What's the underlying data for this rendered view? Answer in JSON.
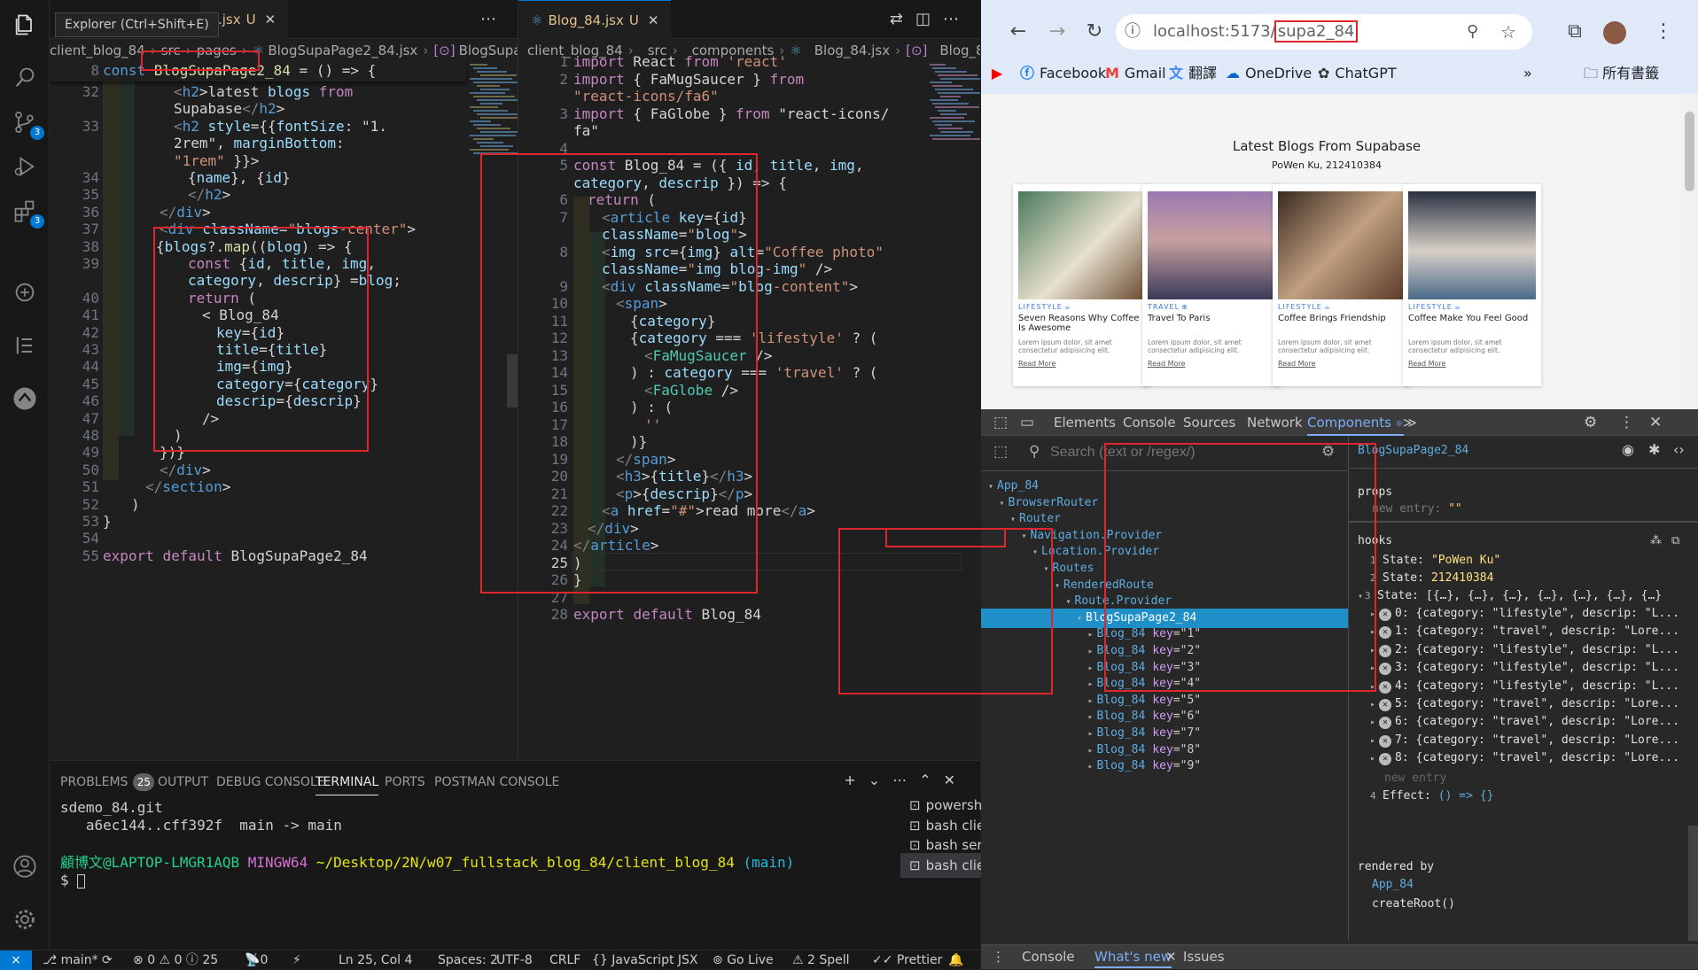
{
  "tooltip": "Explorer (Ctrl+Shift+E)",
  "left_editor": {
    "tab_label": ".jsx",
    "tab_status": "U",
    "breadcrumb": [
      "client_blog_84",
      "src",
      "pages",
      "BlogSupaPage2_84.jsx",
      "BlogSupaP"
    ],
    "sticky": {
      "ln": "8",
      "pre": "const ",
      "name": "BlogSupaPage2_84",
      "post": " = () => {"
    },
    "lines": [
      {
        "n": "32",
        "t": "<h2>latest blogs from"
      },
      {
        "n": "",
        "t": "Supabase</h2>"
      },
      {
        "n": "33",
        "t": "<h2 style={{fontSize: \"1."
      },
      {
        "n": "",
        "t": "2rem\", marginBottom:"
      },
      {
        "n": "",
        "t": "\"1rem\" }}>"
      },
      {
        "n": "34",
        "t": "{name}, {id}"
      },
      {
        "n": "35",
        "t": "</h2>"
      },
      {
        "n": "36",
        "t": "</div>"
      },
      {
        "n": "37",
        "t": "<div className=\"blogs-center\">"
      },
      {
        "n": "38",
        "t": "{blogs?.map((blog) => {"
      },
      {
        "n": "39",
        "t": "const {id, title, img,"
      },
      {
        "n": "",
        "t": "category, descrip} =blog;"
      },
      {
        "n": "40",
        "t": "return ("
      },
      {
        "n": "41",
        "t": "< Blog_84"
      },
      {
        "n": "42",
        "t": "key={id}"
      },
      {
        "n": "43",
        "t": "title={title}"
      },
      {
        "n": "44",
        "t": "img={img}"
      },
      {
        "n": "45",
        "t": "category={category}"
      },
      {
        "n": "46",
        "t": "descrip={descrip}"
      },
      {
        "n": "47",
        "t": "/>"
      },
      {
        "n": "48",
        "t": ")"
      },
      {
        "n": "49",
        "t": "})}"
      },
      {
        "n": "50",
        "t": "</div>"
      },
      {
        "n": "51",
        "t": "</section>"
      },
      {
        "n": "52",
        "t": ")"
      },
      {
        "n": "53",
        "t": "}"
      },
      {
        "n": "54",
        "t": ""
      },
      {
        "n": "55",
        "t": "export default BlogSupaPage2_84"
      }
    ]
  },
  "right_editor": {
    "tab_label": "Blog_84.jsx",
    "tab_status": "U",
    "breadcrumb": [
      "client_blog_84",
      "src",
      "components",
      "Blog_84.jsx",
      "Blog_84"
    ],
    "lines": [
      {
        "n": "1",
        "t": "import React from 'react'"
      },
      {
        "n": "2",
        "t": "import { FaMugSaucer } from"
      },
      {
        "n": "",
        "t": "\"react-icons/fa6\""
      },
      {
        "n": "3",
        "t": "import { FaGlobe } from \"react-icons/"
      },
      {
        "n": "",
        "t": "fa\""
      },
      {
        "n": "4",
        "t": ""
      },
      {
        "n": "5",
        "t": "const Blog_84 = ({ id, title, img,"
      },
      {
        "n": "",
        "t": "category, descrip }) => {"
      },
      {
        "n": "6",
        "t": "return ("
      },
      {
        "n": "7",
        "t": "<article key={id}"
      },
      {
        "n": "",
        "t": "className=\"blog\">"
      },
      {
        "n": "8",
        "t": "<img src={img} alt=\"Coffee photo\""
      },
      {
        "n": "",
        "t": "className=\"img blog-img\" />"
      },
      {
        "n": "9",
        "t": "<div className=\"blog-content\">"
      },
      {
        "n": "10",
        "t": "<span>"
      },
      {
        "n": "11",
        "t": "{category}"
      },
      {
        "n": "12",
        "t": "{category === 'lifestyle' ? ("
      },
      {
        "n": "13",
        "t": "<FaMugSaucer />"
      },
      {
        "n": "14",
        "t": ") : category === 'travel' ? ("
      },
      {
        "n": "15",
        "t": "<FaGlobe />"
      },
      {
        "n": "16",
        "t": ") : ("
      },
      {
        "n": "17",
        "t": "''"
      },
      {
        "n": "18",
        "t": ")}"
      },
      {
        "n": "19",
        "t": "</span>"
      },
      {
        "n": "20",
        "t": "<h3>{title}</h3>"
      },
      {
        "n": "21",
        "t": "<p>{descrip}</p>"
      },
      {
        "n": "22",
        "t": "<a href=\"#\">read more</a>"
      },
      {
        "n": "23",
        "t": "</div>"
      },
      {
        "n": "24",
        "t": "</article>"
      },
      {
        "n": "25",
        "t": ")"
      },
      {
        "n": "26",
        "t": "}"
      },
      {
        "n": "27",
        "t": ""
      },
      {
        "n": "28",
        "t": "export default Blog_84"
      }
    ]
  },
  "panel": {
    "tabs": [
      "PROBLEMS",
      "OUTPUT",
      "DEBUG CONSOLE",
      "TERMINAL",
      "PORTS",
      "POSTMAN CONSOLE"
    ],
    "problems_count": "25",
    "terminal": [
      "sdemo_84.git",
      "   a6ec144..cff392f  main -> main",
      "",
      ""
    ],
    "prompt_user": "顧博文@LAPTOP-LMGR1AQB",
    "prompt_env": "MINGW64",
    "prompt_path": "~/Desktop/2N/w07_fullstack_blog_84/client_blog_84",
    "prompt_branch": "(main)",
    "prompt_char": "$",
    "terminals": [
      "powershell",
      "bash  client_...",
      "bash  server_...",
      "bash  client_..."
    ]
  },
  "status": {
    "branch": "main*",
    "errors": "0",
    "warnings": "0",
    "infos": "25",
    "ports": "0",
    "position": "Ln 25, Col 4",
    "spaces": "Spaces: 2",
    "encoding": "UTF-8",
    "eol": "CRLF",
    "lang": "JavaScript JSX",
    "golive": "Go Live",
    "spell": "2 Spell",
    "prettier": "Prettier"
  },
  "browser": {
    "url_host": "localhost:5173/",
    "url_path": "supa2_84",
    "bookmarks": [
      "Facebook",
      "Gmail",
      "翻譯",
      "OneDrive",
      "ChatGPT"
    ],
    "all_bookmarks": "所有書籤",
    "page_title": "Latest Blogs From Supabase",
    "page_subtitle": "PoWen Ku, 212410384",
    "cards": [
      {
        "cat": "LIFESTYLE",
        "title": "Seven Reasons Why Coffee Is Awesome",
        "desc": "Lorem ipsum dolor, sit amet consectetur adipisicing elit.",
        "more": "Read More"
      },
      {
        "cat": "TRAVEL",
        "title": "Travel To Paris",
        "desc": "Lorem ipsum dolor, sit amet consectetur adipisicing elit.",
        "more": "Read More"
      },
      {
        "cat": "LIFESTYLE",
        "title": "Coffee Brings Friendship",
        "desc": "Lorem ipsum dolor, sit amet consectetur adipisicing elit.",
        "more": "Read More"
      },
      {
        "cat": "LIFESTYLE",
        "title": "Coffee Make You Feel Good",
        "desc": "Lorem ipsum dolor, sit amet consectetur adipisicing elit.",
        "more": "Read More"
      }
    ]
  },
  "devtools": {
    "tabs": [
      "Elements",
      "Console",
      "Sources",
      "Network",
      "Components"
    ],
    "search_placeholder": "Search (text or /regex/)",
    "selected_component": "BlogSupaPage2_84",
    "tree": [
      {
        "d": 0,
        "t": "App_84"
      },
      {
        "d": 1,
        "t": "BrowserRouter"
      },
      {
        "d": 2,
        "t": "Router"
      },
      {
        "d": 3,
        "t": "Navigation.Provider"
      },
      {
        "d": 4,
        "t": "Location.Provider"
      },
      {
        "d": 5,
        "t": "Routes"
      },
      {
        "d": 6,
        "t": "RenderedRoute"
      },
      {
        "d": 7,
        "t": "Route.Provider"
      },
      {
        "d": 8,
        "t": "BlogSupaPage2_84",
        "sel": true
      },
      {
        "d": 9,
        "t": "Blog_84",
        "key": "1"
      },
      {
        "d": 9,
        "t": "Blog_84",
        "key": "2"
      },
      {
        "d": 9,
        "t": "Blog_84",
        "key": "3"
      },
      {
        "d": 9,
        "t": "Blog_84",
        "key": "4"
      },
      {
        "d": 9,
        "t": "Blog_84",
        "key": "5"
      },
      {
        "d": 9,
        "t": "Blog_84",
        "key": "6"
      },
      {
        "d": 9,
        "t": "Blog_84",
        "key": "7"
      },
      {
        "d": 9,
        "t": "Blog_84",
        "key": "8"
      },
      {
        "d": 9,
        "t": "Blog_84",
        "key": "9"
      }
    ],
    "props_label": "props",
    "new_entry": "new entry",
    "new_entry_val": "\"\"",
    "hooks_label": "hooks",
    "state1": "\"PoWen Ku\"",
    "state2": "212410384",
    "state3": "[{…}, {…}, {…}, {…}, {…}, {…}, {…}",
    "items": [
      "0: {category: \"lifestyle\", descrip: \"L...",
      "1: {category: \"travel\", descrip: \"Lore...",
      "2: {category: \"lifestyle\", descrip: \"L...",
      "3: {category: \"lifestyle\", descrip: \"L...",
      "4: {category: \"lifestyle\", descrip: \"L...",
      "5: {category: \"travel\", descrip: \"Lore...",
      "6: {category: \"travel\", descrip: \"Lore...",
      "7: {category: \"travel\", descrip: \"Lore...",
      "8: {category: \"travel\", descrip: \"Lore..."
    ],
    "effect": "() => {}",
    "rendered_by": "rendered by",
    "rendered_list": [
      "App_84",
      "createRoot()"
    ],
    "drawer_tabs": [
      "Console",
      "What's new",
      "Issues"
    ]
  }
}
